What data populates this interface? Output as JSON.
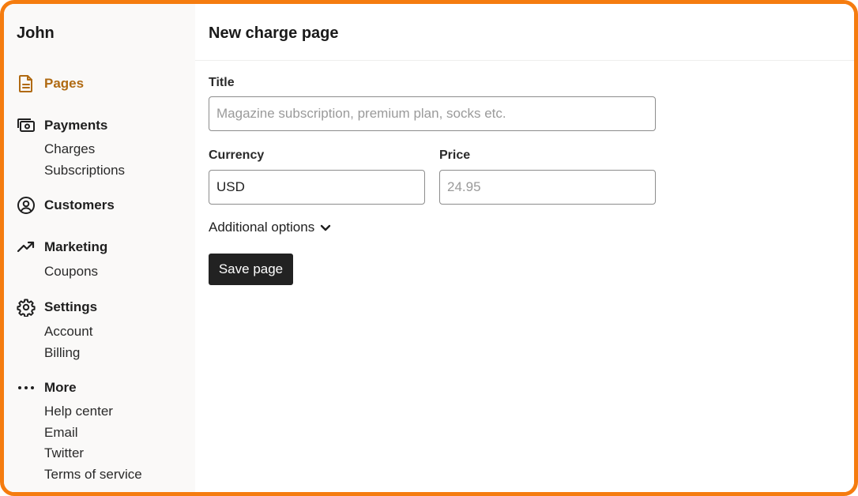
{
  "sidebar": {
    "brand": "John",
    "groups": [
      {
        "label": "Pages",
        "icon": "document-icon",
        "active": true,
        "items": []
      },
      {
        "label": "Payments",
        "icon": "cash-icon",
        "items": [
          "Charges",
          "Subscriptions"
        ]
      },
      {
        "label": "Customers",
        "icon": "user-circle-icon",
        "items": []
      },
      {
        "label": "Marketing",
        "icon": "trending-up-icon",
        "items": [
          "Coupons"
        ]
      },
      {
        "label": "Settings",
        "icon": "gear-icon",
        "items": [
          "Account",
          "Billing"
        ]
      },
      {
        "label": "More",
        "icon": "ellipsis-icon",
        "items": [
          "Help center",
          "Email",
          "Twitter",
          "Terms of service"
        ]
      }
    ]
  },
  "main": {
    "title": "New charge page",
    "form": {
      "title_label": "Title",
      "title_value": "",
      "title_placeholder": "Magazine subscription, premium plan, socks etc.",
      "currency_label": "Currency",
      "currency_value": "USD",
      "price_label": "Price",
      "price_value": "",
      "price_placeholder": "24.95",
      "additional_options": "Additional options",
      "save_label": "Save page"
    }
  },
  "colors": {
    "frame_border": "#f57c0f",
    "active_nav": "#b06a12",
    "sidebar_bg": "#faf9f8",
    "button_bg": "#222222"
  }
}
